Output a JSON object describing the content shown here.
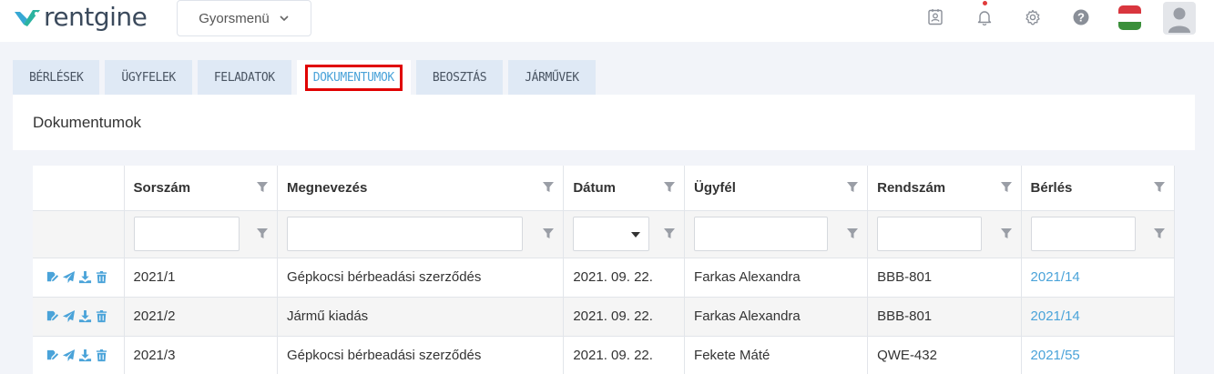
{
  "app": {
    "logo_text": "rentgine"
  },
  "topbar": {
    "quick_menu_label": "Gyorsmenü",
    "icons": [
      "contact-card-icon",
      "bell-icon",
      "gear-icon",
      "help-icon",
      "hungarian-flag-icon",
      "user-avatar-icon"
    ]
  },
  "tabs": [
    {
      "label": "BÉRLÉSEK"
    },
    {
      "label": "ÜGYFELEK"
    },
    {
      "label": "FELADATOK"
    },
    {
      "label": "DOKUMENTUMOK",
      "active": true
    },
    {
      "label": "BEOSZTÁS"
    },
    {
      "label": "JÁRMŰVEK"
    }
  ],
  "panel": {
    "title": "Dokumentumok"
  },
  "table": {
    "columns": [
      {
        "label": ""
      },
      {
        "label": "Sorszám"
      },
      {
        "label": "Megnevezés"
      },
      {
        "label": "Dátum"
      },
      {
        "label": "Ügyfél"
      },
      {
        "label": "Rendszám"
      },
      {
        "label": "Bérlés"
      }
    ],
    "rows": [
      {
        "sorszam": "2021/1",
        "megnevezes": "Gépkocsi bérbeadási szerződés",
        "datum": "2021. 09. 22.",
        "ugyfel": "Farkas Alexandra",
        "rendszam": "BBB-801",
        "berles": "2021/14"
      },
      {
        "sorszam": "2021/2",
        "megnevezes": "Jármű kiadás",
        "datum": "2021. 09. 22.",
        "ugyfel": "Farkas Alexandra",
        "rendszam": "BBB-801",
        "berles": "2021/14"
      },
      {
        "sorszam": "2021/3",
        "megnevezes": "Gépkocsi bérbeadási szerződés",
        "datum": "2021. 09. 22.",
        "ugyfel": "Fekete Máté",
        "rendszam": "QWE-432",
        "berles": "2021/55"
      }
    ],
    "row_actions": [
      "edit-icon",
      "send-icon",
      "download-icon",
      "delete-icon"
    ]
  },
  "colors": {
    "accent": "#4aa3d9",
    "tab_bg": "#dfe9f5",
    "highlight": "#e00000",
    "flag_red": "#d9363e",
    "flag_white": "#ffffff",
    "flag_green": "#3a8f3a"
  }
}
